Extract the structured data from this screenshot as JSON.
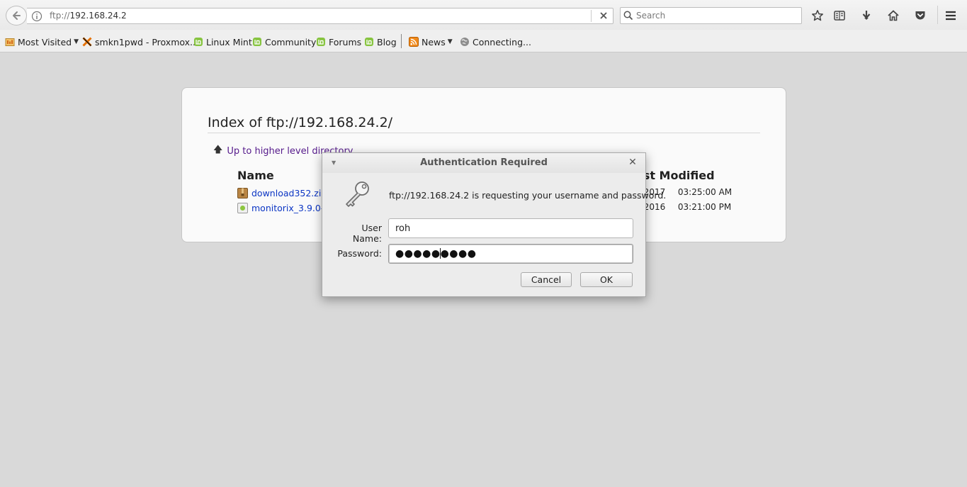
{
  "navbar": {
    "url_protocol": "ftp://",
    "url_host": "192.168.24.2",
    "search_placeholder": "Search"
  },
  "bookmarks": [
    {
      "label": "Most Visited",
      "icon": "folder-icon",
      "dropdown": true
    },
    {
      "label": "smkn1pwd - Proxmox...",
      "icon": "proxmox-icon",
      "dropdown": false
    },
    {
      "label": "Linux Mint",
      "icon": "mint-icon",
      "dropdown": false
    },
    {
      "label": "Community",
      "icon": "mint-icon",
      "dropdown": false
    },
    {
      "label": "Forums",
      "icon": "mint-icon",
      "dropdown": false
    },
    {
      "label": "Blog",
      "icon": "mint-icon",
      "dropdown": false
    },
    {
      "label": "News",
      "icon": "rss-icon",
      "dropdown": true
    },
    {
      "label": "Connecting...",
      "icon": "globe-icon",
      "dropdown": false
    }
  ],
  "page": {
    "title": "Index of ftp://192.168.24.2/",
    "up_link": "Up to higher level directory",
    "col_name": "Name",
    "col_modified": "ast Modified",
    "files": [
      {
        "name": "download352.zip",
        "date": "7/2017",
        "time": "03:25:00 AM"
      },
      {
        "name": "monitorix_3.9.0-iz",
        "date": "6/2016",
        "time": "03:21:00 PM"
      }
    ]
  },
  "dialog": {
    "title": "Authentication Required",
    "message": "ftp://192.168.24.2 is requesting your username and password.",
    "username_label": "User Name:",
    "username_value": "roh",
    "password_label": "Password:",
    "password_mask": "●●●●●●●●●",
    "cancel_label": "Cancel",
    "ok_label": "OK"
  },
  "colors": {
    "link": "#0b35c4",
    "visited_link": "#551a8b",
    "page_bg": "#d9d9d9"
  }
}
